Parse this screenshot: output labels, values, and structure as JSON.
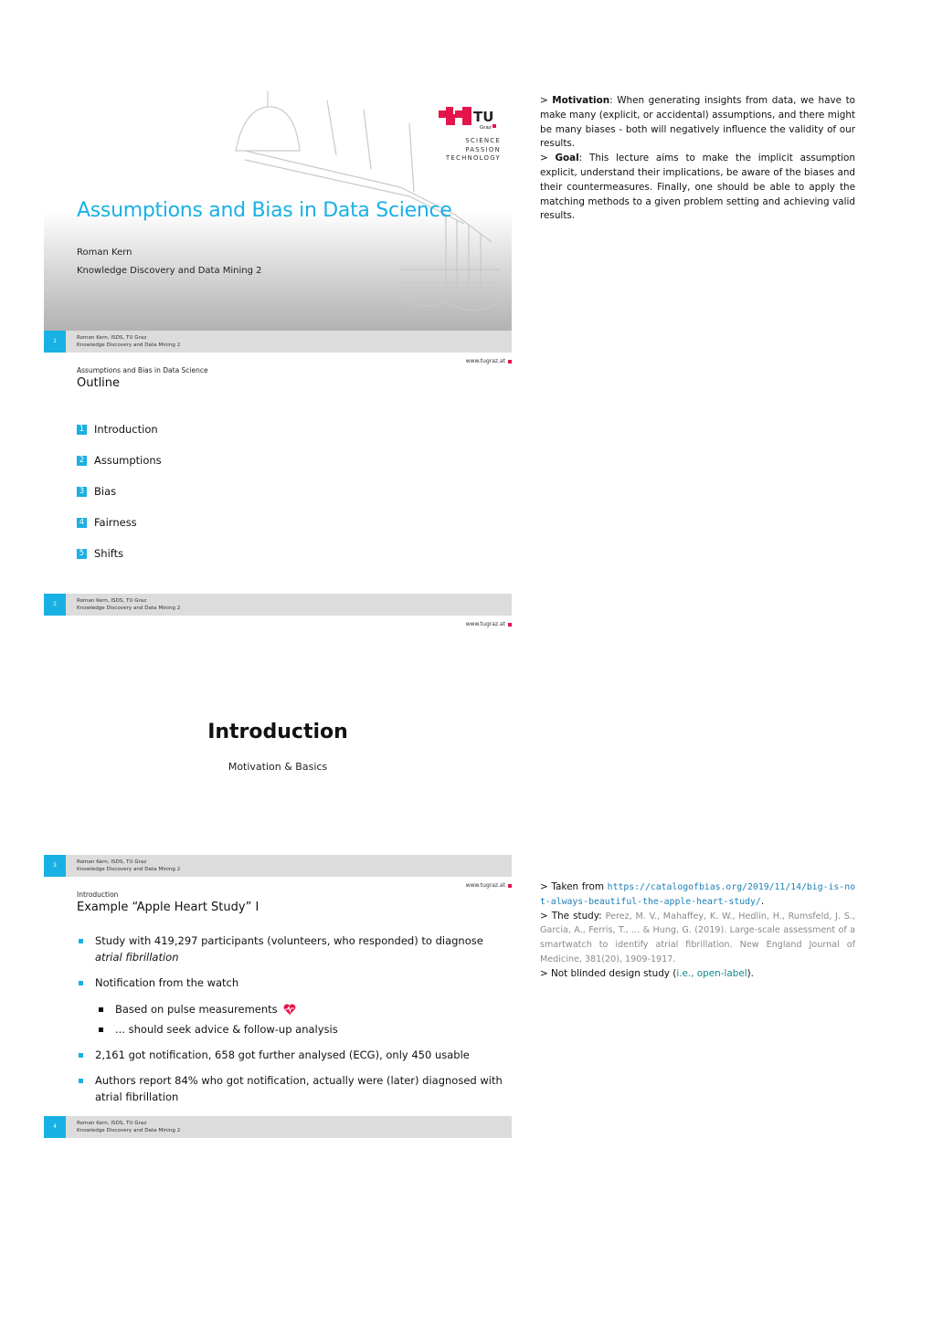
{
  "common": {
    "footer_line1": "Roman Kern, ISDS, TU Graz",
    "footer_line2": "Knowledge Discovery and Data Mining 2",
    "url": "www.tugraz.at",
    "accent": "#19b0e4",
    "brand_red": "#e4154b"
  },
  "slide1": {
    "number": "1",
    "title": "Assumptions and Bias in Data Science",
    "author": "Roman Kern",
    "course": "Knowledge Discovery and Data Mining 2",
    "logo": {
      "name": "TU",
      "sub": "Graz",
      "tagline": [
        "SCIENCE",
        "PASSION",
        "TECHNOLOGY"
      ]
    }
  },
  "notes1": {
    "motivation_prefix": "> ",
    "motivation_label": "Motivation",
    "motivation_text": ": When generating insights from data, we have to make many (explicit, or accidental) assumptions, and there might be many biases - both will negatively influence the validity of our results.",
    "goal_prefix": "> ",
    "goal_label": "Goal",
    "goal_text": ": This lecture aims to make the implicit assumption explicit, understand their implications, be aware of the biases and their countermeasures. Finally, one should be able to apply the matching methods to a given problem setting and achieving valid results."
  },
  "slide2": {
    "number": "2",
    "kicker": "Assumptions and Bias in Data Science",
    "title": "Outline",
    "toc": [
      {
        "num": "1",
        "label": "Introduction"
      },
      {
        "num": "2",
        "label": "Assumptions"
      },
      {
        "num": "3",
        "label": "Bias"
      },
      {
        "num": "4",
        "label": "Fairness"
      },
      {
        "num": "5",
        "label": "Shifts"
      }
    ]
  },
  "slide3": {
    "number": "3",
    "title": "Introduction",
    "subtitle": "Motivation & Basics"
  },
  "slide4": {
    "number": "4",
    "kicker": "Introduction",
    "title": "Example “Apple Heart Study” I",
    "bullets": [
      {
        "text_before": "Study with 419,297 participants (volunteers, who responded) to diagnose ",
        "text_italic": "atrial fibrillation"
      },
      {
        "text": "Notification from the watch"
      },
      {
        "text": "2,161 got notification, 658 got further analysed (ECG), only 450 usable"
      },
      {
        "text": "Authors report 84% who got notification, actually were (later) diagnosed with atrial fibrillation"
      }
    ],
    "subbullets": [
      {
        "text": "Based on pulse measurements",
        "icon": "heartbeat-icon"
      },
      {
        "text": "... should seek advice & follow-up analysis"
      }
    ]
  },
  "notes4": {
    "taken_from": "> Taken from ",
    "link": "https://catalogofbias.org/2019/11/14/big-is-not-always-beautiful-the-apple-heart-study/",
    "link_suffix": ".",
    "study_label": "> The study: ",
    "study_citation": "Perez, M. V., Mahaffey, K. W., Hedlin, H., Rumsfeld, J. S., Garcia, A., Ferris, T., ... & Hung, G. (2019). Large-scale assessment of a smartwatch to identify atrial fibrillation. New England Journal of Medicine, 381(20), 1909-1917.",
    "blind_prefix": "> Not blinded design study (",
    "blind_link": "i.e., open-label",
    "blind_suffix": ")."
  }
}
